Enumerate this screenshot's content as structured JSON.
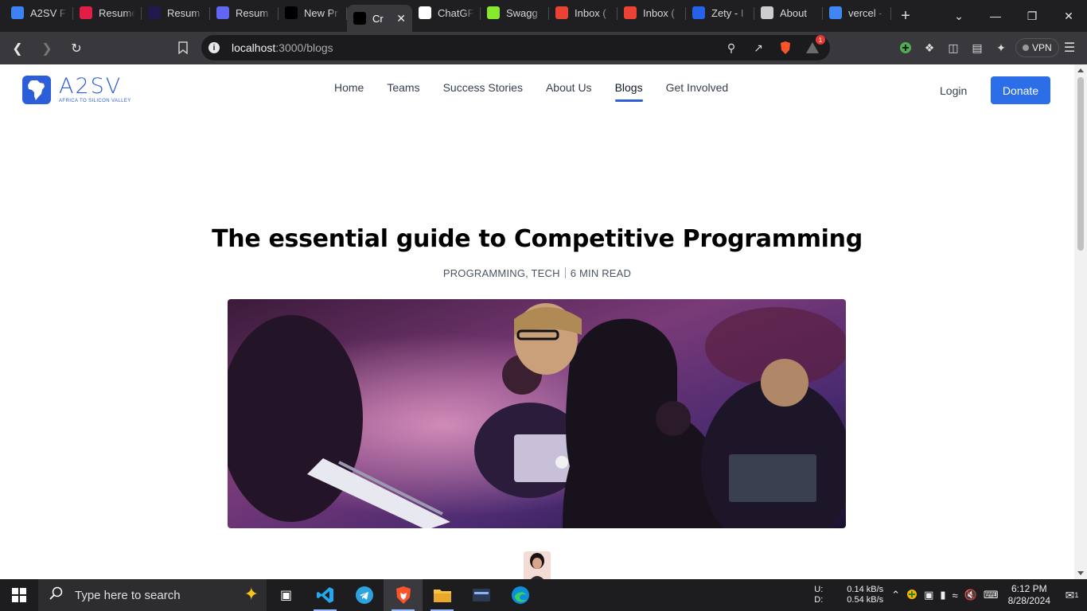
{
  "browser": {
    "tabs": [
      {
        "label": "A2SV F",
        "icon": "calendar-icon",
        "color": "#3b82f6"
      },
      {
        "label": "Resume",
        "icon": "resume-icon",
        "color": "#e11d48"
      },
      {
        "label": "Resum",
        "icon": "r-logo-icon",
        "color": "#1e1b4b"
      },
      {
        "label": "Resum",
        "icon": "shield-icon",
        "color": "#6366f1"
      },
      {
        "label": "New Pr",
        "icon": "vercel-icon",
        "color": "#000000"
      },
      {
        "label": "Cr",
        "icon": "vercel-icon",
        "color": "#000000",
        "active": true
      },
      {
        "label": "ChatGF",
        "icon": "chatgpt-icon",
        "color": "#ffffff"
      },
      {
        "label": "Swagg",
        "icon": "swagger-icon",
        "color": "#85ea2d"
      },
      {
        "label": "Inbox (",
        "icon": "gmail-icon",
        "color": "#ea4335"
      },
      {
        "label": "Inbox (",
        "icon": "gmail-icon",
        "color": "#ea4335"
      },
      {
        "label": "Zety - I",
        "icon": "zety-icon",
        "color": "#2563eb"
      },
      {
        "label": "About",
        "icon": "chrome-icon",
        "color": "#cccccc"
      },
      {
        "label": "vercel -",
        "icon": "google-icon",
        "color": "#4285f4"
      }
    ],
    "new_tab": "+",
    "url_host": "localhost",
    "url_path": ":3000/blogs",
    "vpn_label": "VPN",
    "brave_badge": "1"
  },
  "site": {
    "logo_word": "A2SV",
    "logo_tagline": "AFRICA TO SILICON VALLEY",
    "nav": [
      "Home",
      "Teams",
      "Success Stories",
      "About Us",
      "Blogs",
      "Get Involved"
    ],
    "active_nav": "Blogs",
    "login": "Login",
    "donate": "Donate",
    "accent": "#2b6ee8"
  },
  "article": {
    "title": "The essential guide to Competitive Programming",
    "tags": "PROGRAMMING, TECH",
    "read_time": "6 MIN READ"
  },
  "taskbar": {
    "search_placeholder": "Type here to search",
    "net_up_label": "U:",
    "net_down_label": "D:",
    "net_up": "0.14 kB/s",
    "net_down": "0.54 kB/s",
    "time": "6:12 PM",
    "date": "8/28/2024",
    "notifications": "1"
  }
}
